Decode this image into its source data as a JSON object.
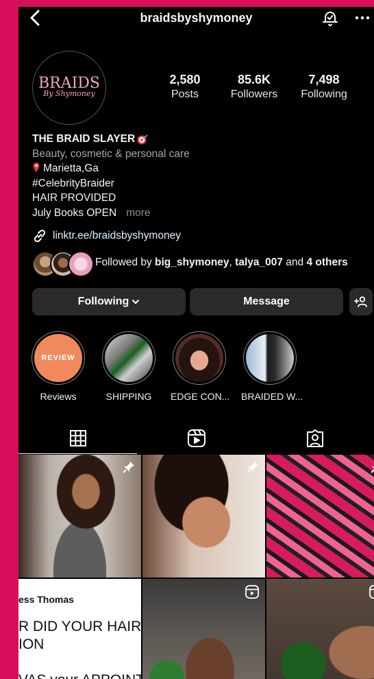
{
  "header": {
    "username": "braidsbyshymoney"
  },
  "profile": {
    "avatar_logo": "BRAIDS",
    "avatar_logo_sub": "By Shymoney",
    "stats": [
      {
        "value": "2,580",
        "label": "Posts"
      },
      {
        "value": "85.6K",
        "label": "Followers"
      },
      {
        "value": "7,498",
        "label": "Following"
      }
    ],
    "name": "THE BRAID SLAYER",
    "category": "Beauty, cosmetic & personal care",
    "bio_lines": [
      "Marietta,Ga",
      "#CelebrityBraider",
      "HAIR PROVIDED",
      "July Books OPEN"
    ],
    "more_label": "more",
    "link": "linktr.ee/braidsbyshymoney",
    "followed_by": {
      "prefix": "Followed by ",
      "user1": "big_shymoney",
      "sep": ", ",
      "user2": "talya_007",
      "and": " and ",
      "others": "4 others"
    }
  },
  "buttons": {
    "following": "Following",
    "message": "Message"
  },
  "highlights": [
    {
      "label": "Reviews",
      "cover_text": "REVIEW"
    },
    {
      "label": "SHIPPING"
    },
    {
      "label": "EDGE CON..."
    },
    {
      "label": "BRAIDED W..."
    }
  ],
  "posts": {
    "text_post": {
      "author": "ess Thomas",
      "lines": [
        "R DID YOUR HAIR ,",
        "ION",
        "VAS your APPOINTM"
      ]
    }
  },
  "colors": {
    "frame": "#d70f5b",
    "background": "#000000",
    "button": "#2a2a2a",
    "review_cover": "#f08a5d"
  }
}
